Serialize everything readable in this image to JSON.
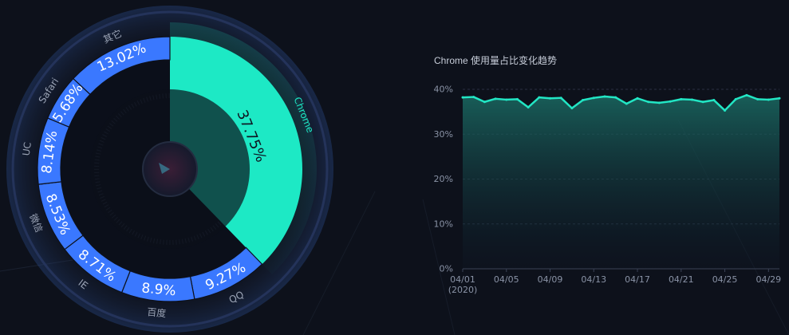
{
  "colors": {
    "background": "#0d111b",
    "donut_blue": "#3a78ff",
    "chrome_accent": "#1de9c5",
    "line_accent": "#22e6c4",
    "grid": "#2a3040"
  },
  "chart_data": [
    {
      "type": "pie",
      "style": "donut",
      "slices": [
        {
          "label": "Chrome",
          "value": 37.75,
          "value_text": "37.75%",
          "highlighted": true
        },
        {
          "label": "QQ",
          "value": 9.27,
          "value_text": "9.27%"
        },
        {
          "label": "百度",
          "value": 8.9,
          "value_text": "8.9%"
        },
        {
          "label": "IE",
          "value": 8.71,
          "value_text": "8.71%"
        },
        {
          "label": "微信",
          "value": 8.53,
          "value_text": "8.53%"
        },
        {
          "label": "UC",
          "value": 8.14,
          "value_text": "8.14%"
        },
        {
          "label": "Safari",
          "value": 5.68,
          "value_text": "5.68%"
        },
        {
          "label": "其它",
          "value": 13.02,
          "value_text": "13.02%"
        }
      ]
    },
    {
      "type": "area",
      "title": "Chrome 使用量占比变化趋势",
      "x": [
        "04/01",
        "04/02",
        "04/03",
        "04/04",
        "04/05",
        "04/06",
        "04/07",
        "04/08",
        "04/09",
        "04/10",
        "04/11",
        "04/12",
        "04/13",
        "04/14",
        "04/15",
        "04/16",
        "04/17",
        "04/18",
        "04/19",
        "04/20",
        "04/21",
        "04/22",
        "04/23",
        "04/24",
        "04/25",
        "04/26",
        "04/27",
        "04/28",
        "04/29",
        "04/30"
      ],
      "x_tick_labels": [
        "04/01",
        "04/05",
        "04/09",
        "04/13",
        "04/17",
        "04/21",
        "04/25",
        "04/29"
      ],
      "x_year_label": "(2020)",
      "y_tick_labels": [
        "0%",
        "10%",
        "20%",
        "30%",
        "40%"
      ],
      "ylim": [
        0,
        40
      ],
      "series": [
        {
          "values": [
            38.2,
            38.3,
            37.2,
            37.9,
            37.7,
            37.8,
            36.0,
            38.2,
            38.0,
            38.1,
            35.8,
            37.6,
            38.1,
            38.4,
            38.2,
            36.8,
            38.0,
            37.2,
            37.0,
            37.3,
            37.8,
            37.7,
            37.2,
            37.6,
            35.3,
            37.8,
            38.7,
            37.8,
            37.7,
            38.0
          ]
        }
      ],
      "grid": true
    }
  ]
}
